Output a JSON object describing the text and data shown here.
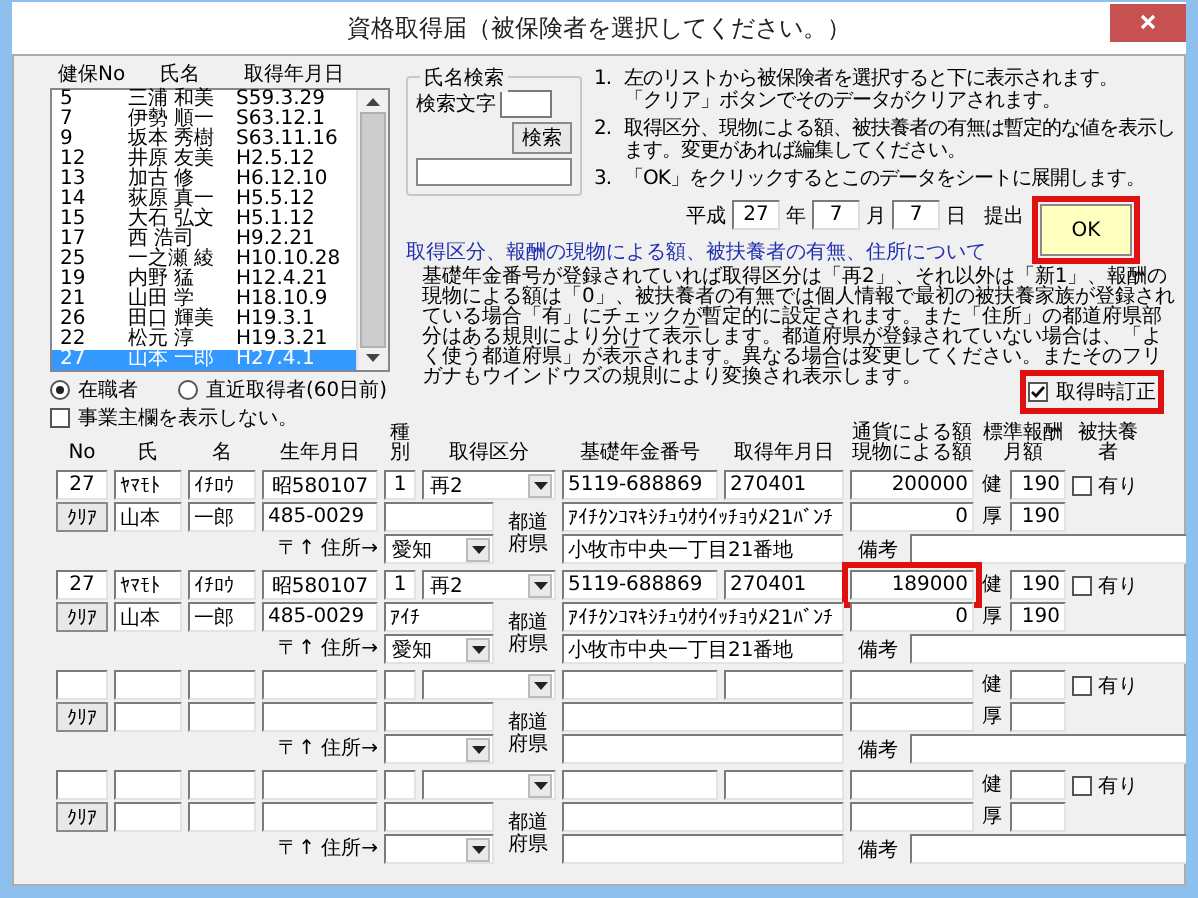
{
  "window": {
    "title": "資格取得届（被保険者を選択してください。）"
  },
  "employee_list": {
    "columns": [
      "健保No",
      "氏名",
      "取得年月日"
    ],
    "rows": [
      {
        "no": "5",
        "name": "三浦 和美",
        "date": "S59.3.29",
        "selected": false
      },
      {
        "no": "7",
        "name": "伊勢 順一",
        "date": "S63.12.1",
        "selected": false
      },
      {
        "no": "9",
        "name": "坂本 秀樹",
        "date": "S63.11.16",
        "selected": false
      },
      {
        "no": "12",
        "name": "井原 友美",
        "date": "H2.5.12",
        "selected": false
      },
      {
        "no": "13",
        "name": "加古 修",
        "date": "H6.12.10",
        "selected": false
      },
      {
        "no": "14",
        "name": "荻原 真一",
        "date": "H5.5.12",
        "selected": false
      },
      {
        "no": "15",
        "name": "大石 弘文",
        "date": "H5.1.12",
        "selected": false
      },
      {
        "no": "17",
        "name": "西 浩司",
        "date": "H9.2.21",
        "selected": false
      },
      {
        "no": "25",
        "name": "一之瀬 綾",
        "date": "H10.10.28",
        "selected": false
      },
      {
        "no": "19",
        "name": "内野 猛",
        "date": "H12.4.21",
        "selected": false
      },
      {
        "no": "21",
        "name": "山田 学",
        "date": "H18.10.9",
        "selected": false
      },
      {
        "no": "26",
        "name": "田口 輝美",
        "date": "H19.3.1",
        "selected": false
      },
      {
        "no": "22",
        "name": "松元 淳",
        "date": "H19.3.21",
        "selected": false
      },
      {
        "no": "27",
        "name": "山本 一郎",
        "date": "H27.4.1",
        "selected": true
      }
    ]
  },
  "filter_radios": [
    {
      "label": "在職者",
      "selected": true
    },
    {
      "label": "直近取得者(60日前)",
      "selected": false
    }
  ],
  "hide_employer": {
    "label": "事業主欄を表示しない。",
    "checked": false
  },
  "name_search": {
    "legend": "氏名検索",
    "label": "検索文字",
    "button": "検索"
  },
  "instructions": [
    {
      "number": "1.",
      "lines": [
        "左のリストから被保険者を選択すると下に表示されます。",
        "「クリア」ボタンでそのデータがクリアされます。"
      ]
    },
    {
      "number": "2.",
      "lines": [
        "取得区分、現物による額、被扶養者の有無は暫定的な値を表示します。変更があれば編集してください。"
      ]
    },
    {
      "number": "3.",
      "lines": [
        "「OK」をクリックするとこのデータをシートに展開します。"
      ]
    }
  ],
  "submission_date": {
    "era": "平成",
    "year": "27",
    "year_unit": "年",
    "month": "7",
    "month_unit": "月",
    "day": "7",
    "day_unit": "日",
    "suffix": "提出"
  },
  "ok_button": {
    "label": "OK",
    "highlighted": true
  },
  "notes": {
    "heading": "取得区分、報酬の現物による額、被扶養者の有無、住所について",
    "body": "基礎年金番号が登録されていれば取得区分は「再2」、それ以外は「新1」、報酬の現物による額は「0」、被扶養者の有無では個人情報で最初の被扶養家族が登録されている場合「有」にチェックが暫定的に設定されます。また「住所」の都道府県部分はある規則により分けて表示します。都道府県が登録されていない場合は、「よく使う都道府県」が表示されます。異なる場合は変更してください。またそのフリガナもウインドウズの規則により変換され表示します。"
  },
  "correction": {
    "label": "取得時訂正",
    "checked": true,
    "highlighted": true
  },
  "form": {
    "columns": [
      "No",
      "氏",
      "名",
      "生年月日",
      "種別",
      "取得区分",
      "基礎年金番号",
      "取得年月日",
      "通貨による額現物による額",
      "標準報酬月額",
      "被扶養者"
    ],
    "records": [
      {
        "no": "27",
        "kana_last": "ﾔﾏﾓﾄ",
        "kana_first": "ｲﾁﾛｳ",
        "birth": "昭580107",
        "type": "1",
        "category": "再2",
        "pension_no": "5119-688869",
        "acquired": "270401",
        "cash_amount": "200000",
        "health_label": "健",
        "std_health": "190",
        "dependent": false,
        "dependent_label": "有り",
        "clear": "ｸﾘｱ",
        "last": "山本",
        "first": "一郎",
        "zip": "485-0029",
        "prefecture_label": "都道府県",
        "kana_address": "ｱｲﾁｸﾝｺﾏｷｼﾁｭｳｵｳｲｯﾁｮｳﾒ21ﾊﾞﾝﾁ",
        "kind_amount": "0",
        "pension_label": "厚",
        "std_pension": "190",
        "address_label": "〒↑ 住所→",
        "prefecture": "愛知",
        "address": "小牧市中央一丁目21番地",
        "remark_label": "備考",
        "highlight_amount": false
      },
      {
        "no": "27",
        "kana_last": "ﾔﾏﾓﾄ",
        "kana_first": "ｲﾁﾛｳ",
        "birth": "昭580107",
        "type": "1",
        "category": "再2",
        "pension_no": "5119-688869",
        "acquired": "270401",
        "cash_amount": "189000",
        "health_label": "健",
        "std_health": "190",
        "dependent": false,
        "dependent_label": "有り",
        "clear": "ｸﾘｱ",
        "last": "山本",
        "first": "一郎",
        "zip": "485-0029",
        "kana_prefecture": "ｱｲﾁ",
        "prefecture_label": "都道府県",
        "kana_address": "ｱｲﾁｸﾝｺﾏｷｼﾁｭｳｵｳｲｯﾁｮｳﾒ21ﾊﾞﾝﾁ",
        "kind_amount": "0",
        "pension_label": "厚",
        "std_pension": "190",
        "address_label": "〒↑ 住所→",
        "prefecture": "愛知",
        "address": "小牧市中央一丁目21番地",
        "remark_label": "備考",
        "highlight_amount": true
      },
      {
        "health_label": "健",
        "dependent": false,
        "dependent_label": "有り",
        "clear": "ｸﾘｱ",
        "prefecture_label": "都道府県",
        "pension_label": "厚",
        "address_label": "〒↑ 住所→",
        "remark_label": "備考",
        "highlight_amount": false
      },
      {
        "health_label": "健",
        "dependent": false,
        "dependent_label": "有り",
        "clear": "ｸﾘｱ",
        "prefecture_label": "都道府県",
        "pension_label": "厚",
        "address_label": "〒↑ 住所→",
        "remark_label": "備考",
        "highlight_amount": false
      }
    ]
  }
}
